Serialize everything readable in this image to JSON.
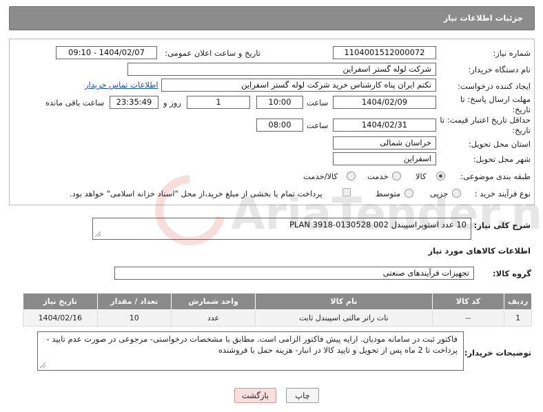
{
  "header": {
    "title": "جزئیات اطلاعات نیاز"
  },
  "labels": {
    "need_number": "شماره نیاز:",
    "announce_datetime": "تاریخ و ساعت اعلان عمومی:",
    "buyer_org": "نام دستگاه خریدار:",
    "creator": "ایجاد کننده درخواست:",
    "reply_deadline": "مهلت ارسال پاسخ: تا تاریخ:",
    "price_validity": "حداقل تاریخ اعتبار قیمت: تا تاریخ:",
    "time": "ساعت",
    "day_and": "روز و",
    "remaining": "ساعت باقی مانده",
    "province": "استان محل تحویل:",
    "city": "شهر محل تحویل:",
    "category": "طبقه بندی موضوعی:",
    "purchase_type": "نوع فرآیند خرید :",
    "description": "شرح کلی نیاز:",
    "goods_info": "اطلاعات کالاهای مورد نیاز",
    "goods_group": "گروه کالا:",
    "buyer_notes": "توضیحات خریدار:"
  },
  "values": {
    "need_number": "1104001512000072",
    "announce_datetime": "1404/02/07 - 09:10",
    "buyer_org": "شرکت لوله گستر اسفراین",
    "creator": "تکتم ایران پناه کارشناس خرید شرکت لوله گستر اسفراین",
    "buyer_contact_link": "اطلاعات تماس خریدار",
    "reply_date": "1404/02/09",
    "reply_time": "10:00",
    "reply_days": "1",
    "reply_remaining": "23:35:49",
    "validity_date": "1404/02/31",
    "validity_time": "08:00",
    "province": "خراسان شمالی",
    "city": "اسفراین",
    "description": "10 عدد استوپراسپیندل PLAN 3918-0130528 002",
    "goods_group": "تجهیزات فرآیندهای صنعتی",
    "buyer_notes": "فاکتور ثبت در سامانه مودیان. ارایه پیش فاکتور الزامی است. مطابق با مشخصات درخواستی- مرجوعی در صورت عدم تایید - پرداخت تا 2 ماه پس از تحویل و تایید کالا در انبار- هزینه حمل با فروشنده"
  },
  "category_options": [
    {
      "label": "کالا",
      "selected": true
    },
    {
      "label": "خدمت",
      "selected": false
    },
    {
      "label": "کالا/خدمت",
      "selected": false
    }
  ],
  "purchase_options": [
    {
      "label": "جزیی",
      "selected": false
    },
    {
      "label": "متوسط",
      "selected": false
    }
  ],
  "treasury_note": "پرداخت تمام یا بخشی از مبلغ خرید،از محل \"اسناد خزانه اسلامی\" خواهد بود.",
  "table": {
    "headers": [
      "ردیف",
      "کد کالا",
      "نام کالا",
      "واحد شمارش",
      "تعداد / مقدار",
      "تاریخ نیاز"
    ],
    "rows": [
      [
        "1",
        "--",
        "نات راتر مالتی اسپیندل ثابت",
        "عدد",
        "10",
        "1404/02/16"
      ]
    ]
  },
  "buttons": {
    "print": "چاپ",
    "back": "بازگشت"
  },
  "watermark": "AriaTender.net",
  "colors": {
    "header_bg": "#8c8c8c",
    "link": "#1a4fa8",
    "back_button_bg": "#f9dede"
  }
}
